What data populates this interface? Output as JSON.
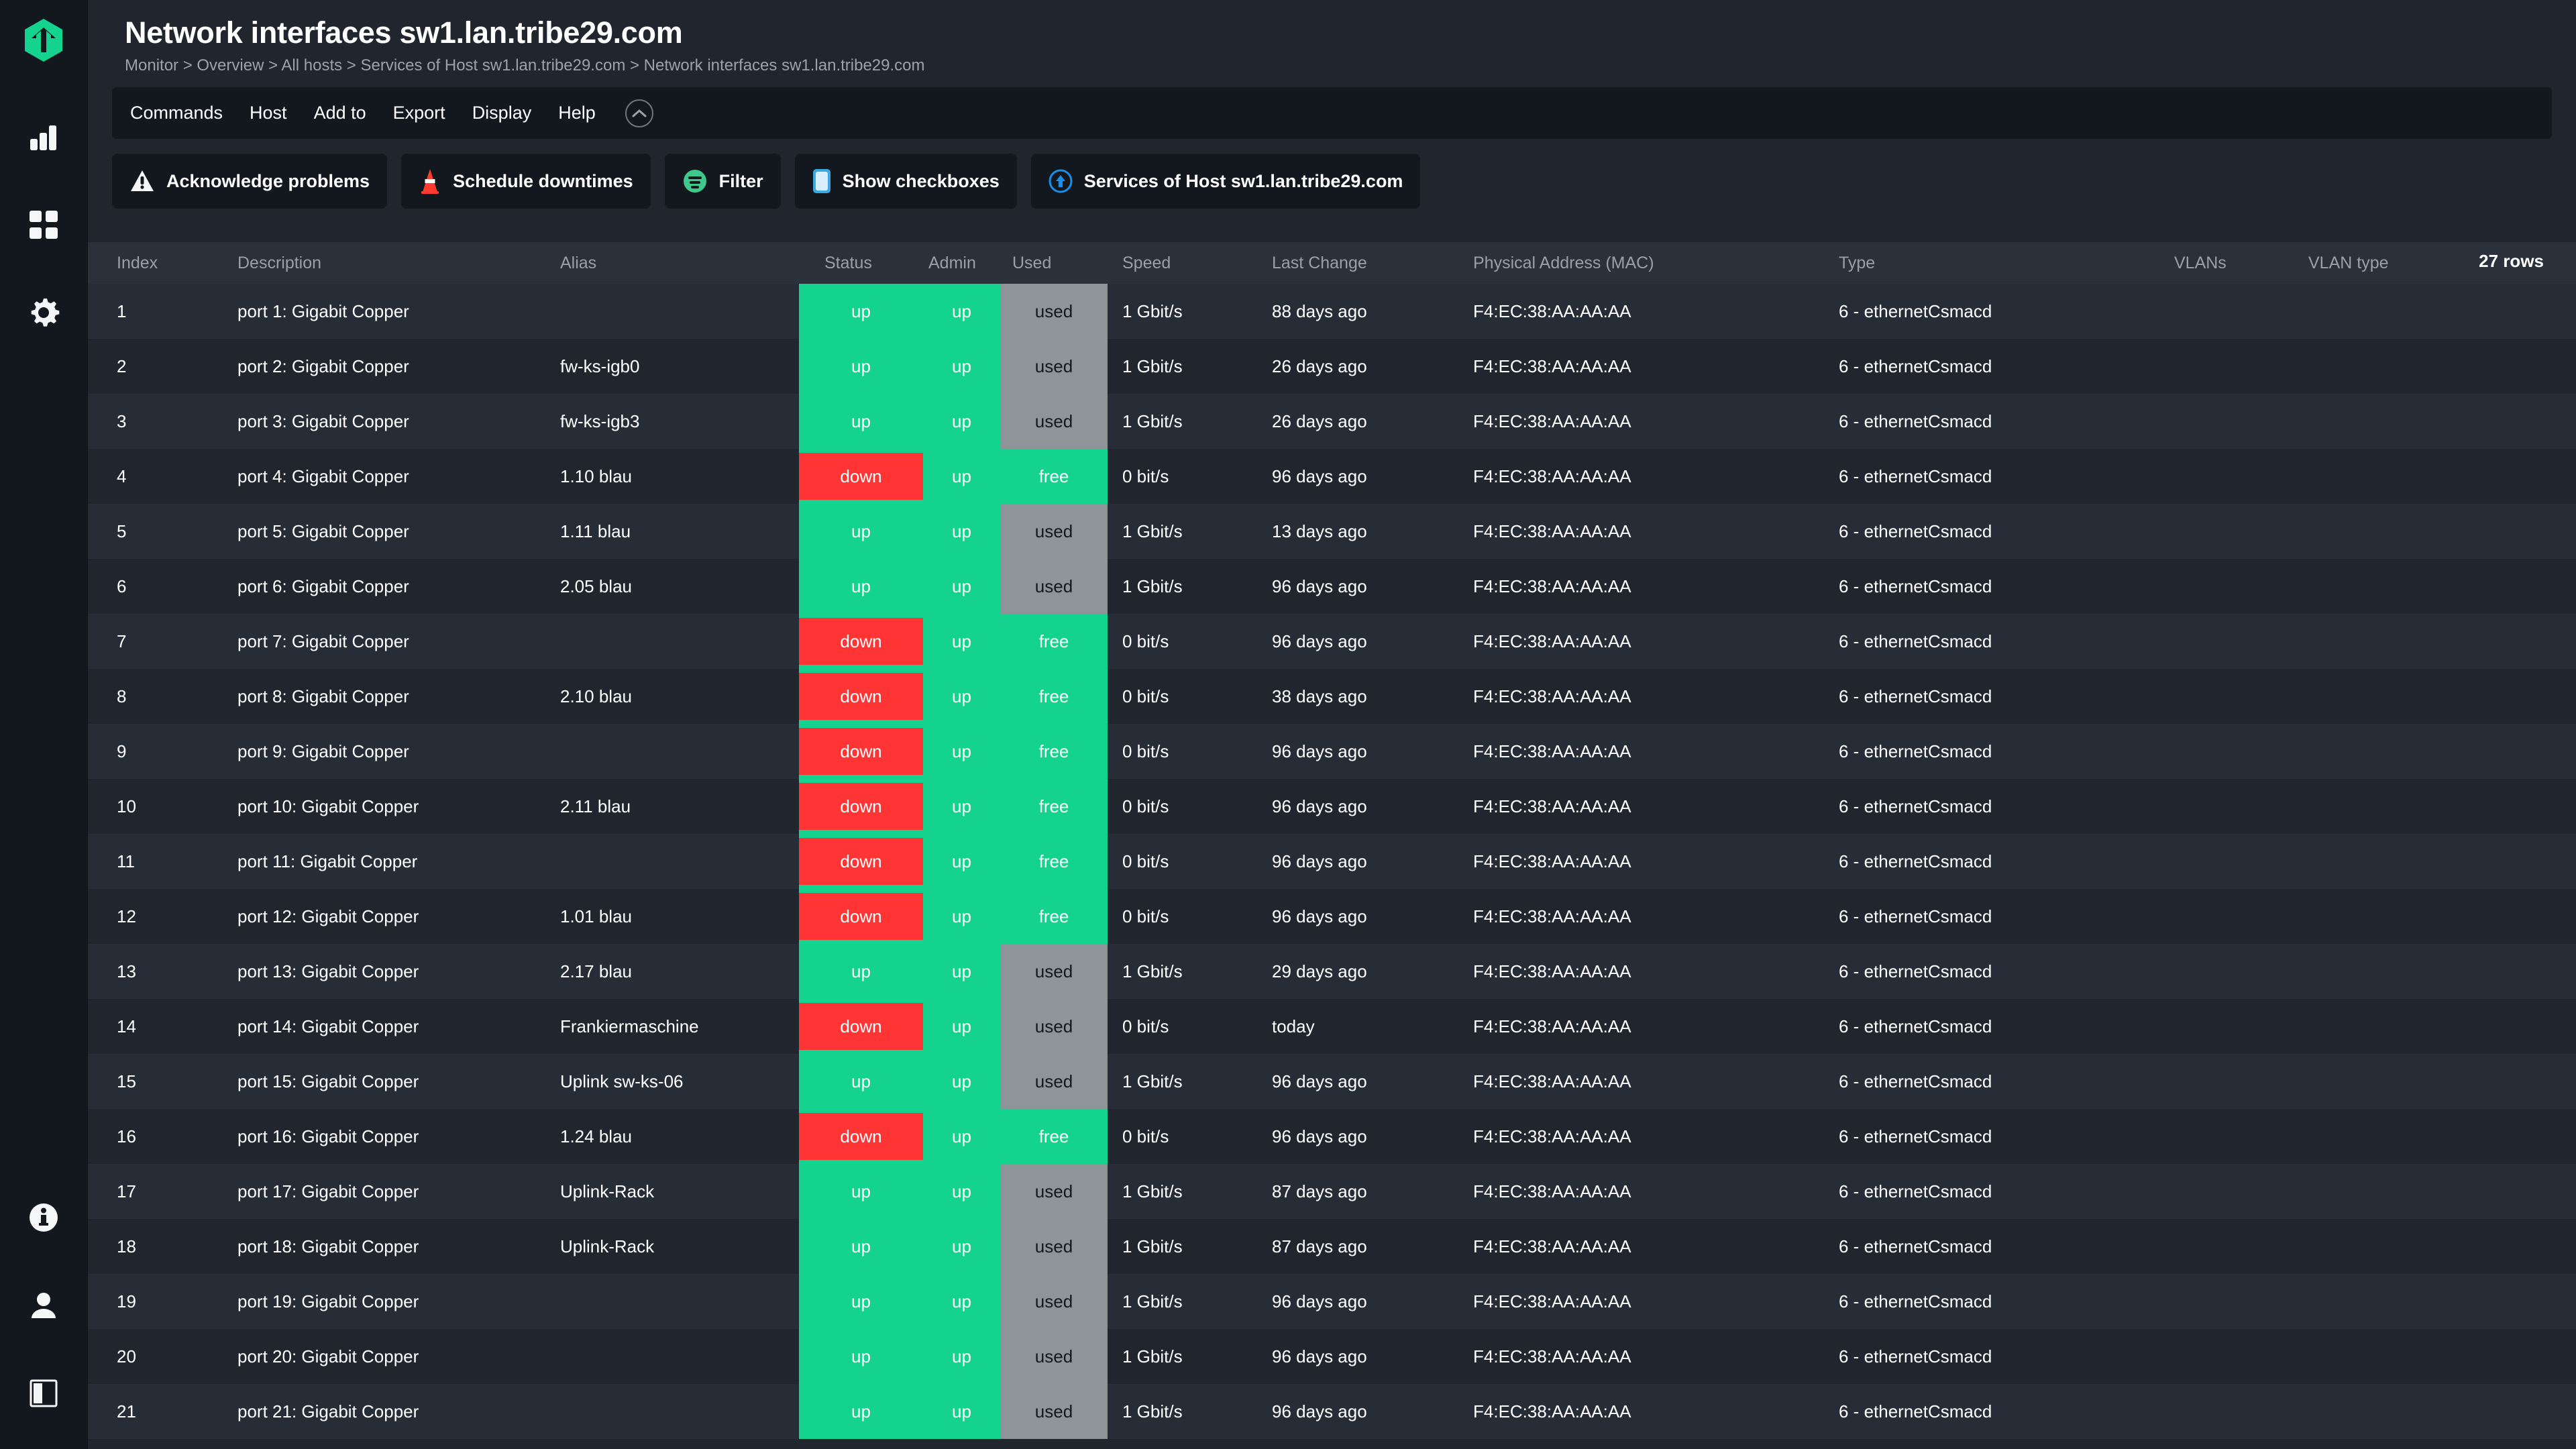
{
  "sidebar": {
    "logo": "checkmk-logo",
    "top_items": [
      {
        "icon": "bar-chart-icon",
        "name": "sidebar-item-monitor"
      },
      {
        "icon": "grid-dashboard-icon",
        "name": "sidebar-item-customize"
      },
      {
        "icon": "gear-icon",
        "name": "sidebar-item-setup"
      }
    ],
    "bottom_items": [
      {
        "icon": "info-circle-icon",
        "name": "sidebar-item-help"
      },
      {
        "icon": "user-icon",
        "name": "sidebar-item-user"
      },
      {
        "icon": "panel-toggle-icon",
        "name": "sidebar-item-toggle"
      }
    ]
  },
  "header": {
    "title": "Network interfaces sw1.lan.tribe29.com",
    "breadcrumb": "Monitor > Overview > All hosts > Services of Host sw1.lan.tribe29.com > Network interfaces sw1.lan.tribe29.com"
  },
  "menu": {
    "items": [
      {
        "label": "Commands",
        "name": "menu-commands"
      },
      {
        "label": "Host",
        "name": "menu-host"
      },
      {
        "label": "Add to",
        "name": "menu-add-to"
      },
      {
        "label": "Export",
        "name": "menu-export"
      },
      {
        "label": "Display",
        "name": "menu-display"
      },
      {
        "label": "Help",
        "name": "menu-help"
      }
    ],
    "collapse_icon": "chevron-up-circle-icon"
  },
  "actions": [
    {
      "label": "Acknowledge problems",
      "icon": "warning-triangle-icon",
      "name": "acknowledge-problems-button"
    },
    {
      "label": "Schedule downtimes",
      "icon": "traffic-cone-icon",
      "name": "schedule-downtimes-button"
    },
    {
      "label": "Filter",
      "icon": "filter-icon",
      "name": "filter-button"
    },
    {
      "label": "Show checkboxes",
      "icon": "checkbox-icon",
      "name": "show-checkboxes-button"
    },
    {
      "label": "Services of Host sw1.lan.tribe29.com",
      "icon": "up-arrow-circle-icon",
      "name": "services-of-host-button"
    }
  ],
  "table": {
    "rows_label": "27 rows",
    "columns": [
      "Index",
      "Description",
      "Alias",
      "Status",
      "Admin",
      "Used",
      "Speed",
      "Last Change",
      "Physical Address (MAC)",
      "Type",
      "VLANs",
      "VLAN type"
    ],
    "rows": [
      {
        "index": "1",
        "description": "port 1: Gigabit Copper",
        "alias": "",
        "status": "up",
        "admin": "up",
        "used": "used",
        "speed": "1 Gbit/s",
        "last_change": "88 days ago",
        "mac": "F4:EC:38:AA:AA:AA",
        "type": "6 - ethernetCsmacd",
        "vlans": "",
        "vlan_type": ""
      },
      {
        "index": "2",
        "description": "port 2: Gigabit Copper",
        "alias": "fw-ks-igb0",
        "status": "up",
        "admin": "up",
        "used": "used",
        "speed": "1 Gbit/s",
        "last_change": "26 days ago",
        "mac": "F4:EC:38:AA:AA:AA",
        "type": "6 - ethernetCsmacd",
        "vlans": "",
        "vlan_type": ""
      },
      {
        "index": "3",
        "description": "port 3: Gigabit Copper",
        "alias": "fw-ks-igb3",
        "status": "up",
        "admin": "up",
        "used": "used",
        "speed": "1 Gbit/s",
        "last_change": "26 days ago",
        "mac": "F4:EC:38:AA:AA:AA",
        "type": "6 - ethernetCsmacd",
        "vlans": "",
        "vlan_type": ""
      },
      {
        "index": "4",
        "description": "port 4: Gigabit Copper",
        "alias": "1.10 blau",
        "status": "down",
        "admin": "up",
        "used": "free",
        "speed": "0 bit/s",
        "last_change": "96 days ago",
        "mac": "F4:EC:38:AA:AA:AA",
        "type": "6 - ethernetCsmacd",
        "vlans": "",
        "vlan_type": ""
      },
      {
        "index": "5",
        "description": "port 5: Gigabit Copper",
        "alias": "1.11 blau",
        "status": "up",
        "admin": "up",
        "used": "used",
        "speed": "1 Gbit/s",
        "last_change": "13 days ago",
        "mac": "F4:EC:38:AA:AA:AA",
        "type": "6 - ethernetCsmacd",
        "vlans": "",
        "vlan_type": ""
      },
      {
        "index": "6",
        "description": "port 6: Gigabit Copper",
        "alias": "2.05 blau",
        "status": "up",
        "admin": "up",
        "used": "used",
        "speed": "1 Gbit/s",
        "last_change": "96 days ago",
        "mac": "F4:EC:38:AA:AA:AA",
        "type": "6 - ethernetCsmacd",
        "vlans": "",
        "vlan_type": ""
      },
      {
        "index": "7",
        "description": "port 7: Gigabit Copper",
        "alias": "",
        "status": "down",
        "admin": "up",
        "used": "free",
        "speed": "0 bit/s",
        "last_change": "96 days ago",
        "mac": "F4:EC:38:AA:AA:AA",
        "type": "6 - ethernetCsmacd",
        "vlans": "",
        "vlan_type": ""
      },
      {
        "index": "8",
        "description": "port 8: Gigabit Copper",
        "alias": "2.10 blau",
        "status": "down",
        "admin": "up",
        "used": "free",
        "speed": "0 bit/s",
        "last_change": "38 days ago",
        "mac": "F4:EC:38:AA:AA:AA",
        "type": "6 - ethernetCsmacd",
        "vlans": "",
        "vlan_type": ""
      },
      {
        "index": "9",
        "description": "port 9: Gigabit Copper",
        "alias": "",
        "status": "down",
        "admin": "up",
        "used": "free",
        "speed": "0 bit/s",
        "last_change": "96 days ago",
        "mac": "F4:EC:38:AA:AA:AA",
        "type": "6 - ethernetCsmacd",
        "vlans": "",
        "vlan_type": ""
      },
      {
        "index": "10",
        "description": "port 10: Gigabit Copper",
        "alias": "2.11 blau",
        "status": "down",
        "admin": "up",
        "used": "free",
        "speed": "0 bit/s",
        "last_change": "96 days ago",
        "mac": "F4:EC:38:AA:AA:AA",
        "type": "6 - ethernetCsmacd",
        "vlans": "",
        "vlan_type": ""
      },
      {
        "index": "11",
        "description": "port 11: Gigabit Copper",
        "alias": "",
        "status": "down",
        "admin": "up",
        "used": "free",
        "speed": "0 bit/s",
        "last_change": "96 days ago",
        "mac": "F4:EC:38:AA:AA:AA",
        "type": "6 - ethernetCsmacd",
        "vlans": "",
        "vlan_type": ""
      },
      {
        "index": "12",
        "description": "port 12: Gigabit Copper",
        "alias": "1.01 blau",
        "status": "down",
        "admin": "up",
        "used": "free",
        "speed": "0 bit/s",
        "last_change": "96 days ago",
        "mac": "F4:EC:38:AA:AA:AA",
        "type": "6 - ethernetCsmacd",
        "vlans": "",
        "vlan_type": ""
      },
      {
        "index": "13",
        "description": "port 13: Gigabit Copper",
        "alias": "2.17 blau",
        "status": "up",
        "admin": "up",
        "used": "used",
        "speed": "1 Gbit/s",
        "last_change": "29 days ago",
        "mac": "F4:EC:38:AA:AA:AA",
        "type": "6 - ethernetCsmacd",
        "vlans": "",
        "vlan_type": ""
      },
      {
        "index": "14",
        "description": "port 14: Gigabit Copper",
        "alias": "Frankiermaschine",
        "status": "down",
        "admin": "up",
        "used": "used",
        "speed": "0 bit/s",
        "last_change": "today",
        "mac": "F4:EC:38:AA:AA:AA",
        "type": "6 - ethernetCsmacd",
        "vlans": "",
        "vlan_type": ""
      },
      {
        "index": "15",
        "description": "port 15: Gigabit Copper",
        "alias": "Uplink sw-ks-06",
        "status": "up",
        "admin": "up",
        "used": "used",
        "speed": "1 Gbit/s",
        "last_change": "96 days ago",
        "mac": "F4:EC:38:AA:AA:AA",
        "type": "6 - ethernetCsmacd",
        "vlans": "",
        "vlan_type": ""
      },
      {
        "index": "16",
        "description": "port 16: Gigabit Copper",
        "alias": "1.24 blau",
        "status": "down",
        "admin": "up",
        "used": "free",
        "speed": "0 bit/s",
        "last_change": "96 days ago",
        "mac": "F4:EC:38:AA:AA:AA",
        "type": "6 - ethernetCsmacd",
        "vlans": "",
        "vlan_type": ""
      },
      {
        "index": "17",
        "description": "port 17: Gigabit Copper",
        "alias": "Uplink-Rack",
        "status": "up",
        "admin": "up",
        "used": "used",
        "speed": "1 Gbit/s",
        "last_change": "87 days ago",
        "mac": "F4:EC:38:AA:AA:AA",
        "type": "6 - ethernetCsmacd",
        "vlans": "",
        "vlan_type": ""
      },
      {
        "index": "18",
        "description": "port 18: Gigabit Copper",
        "alias": "Uplink-Rack",
        "status": "up",
        "admin": "up",
        "used": "used",
        "speed": "1 Gbit/s",
        "last_change": "87 days ago",
        "mac": "F4:EC:38:AA:AA:AA",
        "type": "6 - ethernetCsmacd",
        "vlans": "",
        "vlan_type": ""
      },
      {
        "index": "19",
        "description": "port 19: Gigabit Copper",
        "alias": "",
        "status": "up",
        "admin": "up",
        "used": "used",
        "speed": "1 Gbit/s",
        "last_change": "96 days ago",
        "mac": "F4:EC:38:AA:AA:AA",
        "type": "6 - ethernetCsmacd",
        "vlans": "",
        "vlan_type": ""
      },
      {
        "index": "20",
        "description": "port 20: Gigabit Copper",
        "alias": "",
        "status": "up",
        "admin": "up",
        "used": "used",
        "speed": "1 Gbit/s",
        "last_change": "96 days ago",
        "mac": "F4:EC:38:AA:AA:AA",
        "type": "6 - ethernetCsmacd",
        "vlans": "",
        "vlan_type": ""
      },
      {
        "index": "21",
        "description": "port 21: Gigabit Copper",
        "alias": "",
        "status": "up",
        "admin": "up",
        "used": "used",
        "speed": "1 Gbit/s",
        "last_change": "96 days ago",
        "mac": "F4:EC:38:AA:AA:AA",
        "type": "6 - ethernetCsmacd",
        "vlans": "",
        "vlan_type": ""
      }
    ]
  },
  "colors": {
    "accent_green": "#13d38e",
    "state_down_red": "#ff3535",
    "state_used_grey": "#8f9499",
    "page_bg": "#21262e",
    "panel_bg": "#13181f"
  }
}
